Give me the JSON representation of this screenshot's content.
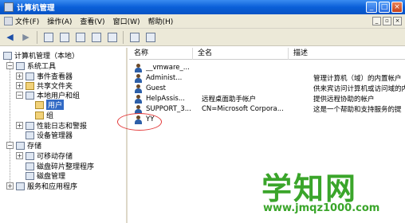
{
  "window": {
    "title": "计算机管理"
  },
  "menu": {
    "items": [
      "文件(F)",
      "操作(A)",
      "查看(V)",
      "窗口(W)",
      "帮助(H)"
    ]
  },
  "tree": {
    "root": "计算机管理（本地）",
    "system_tools": "系统工具",
    "event_viewer": "事件查看器",
    "shared_folders": "共享文件夹",
    "local_users": "本地用户和组",
    "users": "用户",
    "groups": "组",
    "perf_logs": "性能日志和警报",
    "device_manager": "设备管理器",
    "storage": "存储",
    "removable": "可移动存储",
    "defrag": "磁盘碎片整理程序",
    "disk_mgmt": "磁盘管理",
    "services": "服务和应用程序"
  },
  "list": {
    "columns": [
      "名称",
      "全名",
      "描述"
    ],
    "rows": [
      {
        "name": "__vmware_...",
        "full": "",
        "desc": ""
      },
      {
        "name": "Administ...",
        "full": "",
        "desc": "管理计算机（域）的内置帐户"
      },
      {
        "name": "Guest",
        "full": "",
        "desc": "供来宾访问计算机或访问域的内"
      },
      {
        "name": "HelpAssis...",
        "full": "远程桌面助手帐户",
        "desc": "提供远程协助的帐户"
      },
      {
        "name": "SUPPORT_3...",
        "full": "CN=Microsoft Corpora...",
        "desc": "这是一个帮助和支持服务的提"
      },
      {
        "name": "YY",
        "full": "",
        "desc": ""
      }
    ]
  },
  "watermark": {
    "title": "学知网",
    "url": "www.jmqz1000.com"
  }
}
